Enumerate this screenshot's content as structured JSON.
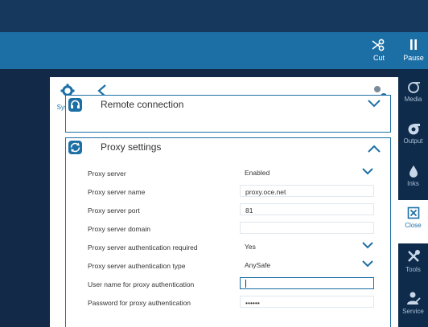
{
  "toolbar": {
    "cut_label": "Cut",
    "pause_label": "Pause"
  },
  "rightbar": {
    "items": [
      {
        "label": "Media",
        "icon": "media-icon"
      },
      {
        "label": "Output",
        "icon": "output-icon"
      },
      {
        "label": "Inks",
        "icon": "ink-drop-icon"
      },
      {
        "label": "Close",
        "icon": "close-icon",
        "active": true
      },
      {
        "label": "Tools",
        "icon": "tools-icon"
      },
      {
        "label": "Service",
        "icon": "service-icon"
      }
    ]
  },
  "header": {
    "system_label": "System"
  },
  "sections": {
    "remote": {
      "title": "Remote connection",
      "expanded": false
    },
    "proxy": {
      "title": "Proxy settings",
      "expanded": true,
      "rows": [
        {
          "label": "Proxy server",
          "value": "Enabled",
          "type": "select"
        },
        {
          "label": "Proxy server name",
          "value": "proxy.oce.net",
          "type": "input"
        },
        {
          "label": "Proxy server port",
          "value": "81",
          "type": "input"
        },
        {
          "label": "Proxy server domain",
          "value": "",
          "type": "input"
        },
        {
          "label": "Proxy server authentication required",
          "value": "Yes",
          "type": "select"
        },
        {
          "label": "Proxy server authentication type",
          "value": "AnySafe",
          "type": "select"
        },
        {
          "label": "User name for proxy authentication",
          "value": "",
          "type": "input-focused"
        },
        {
          "label": "Password for proxy authentication",
          "value": "••••••",
          "type": "password"
        }
      ]
    }
  },
  "colors": {
    "accent": "#1c6fa5",
    "top_band": "#16385c",
    "dark_bg": "#122a47",
    "right_bar": "#0f2b4b"
  }
}
